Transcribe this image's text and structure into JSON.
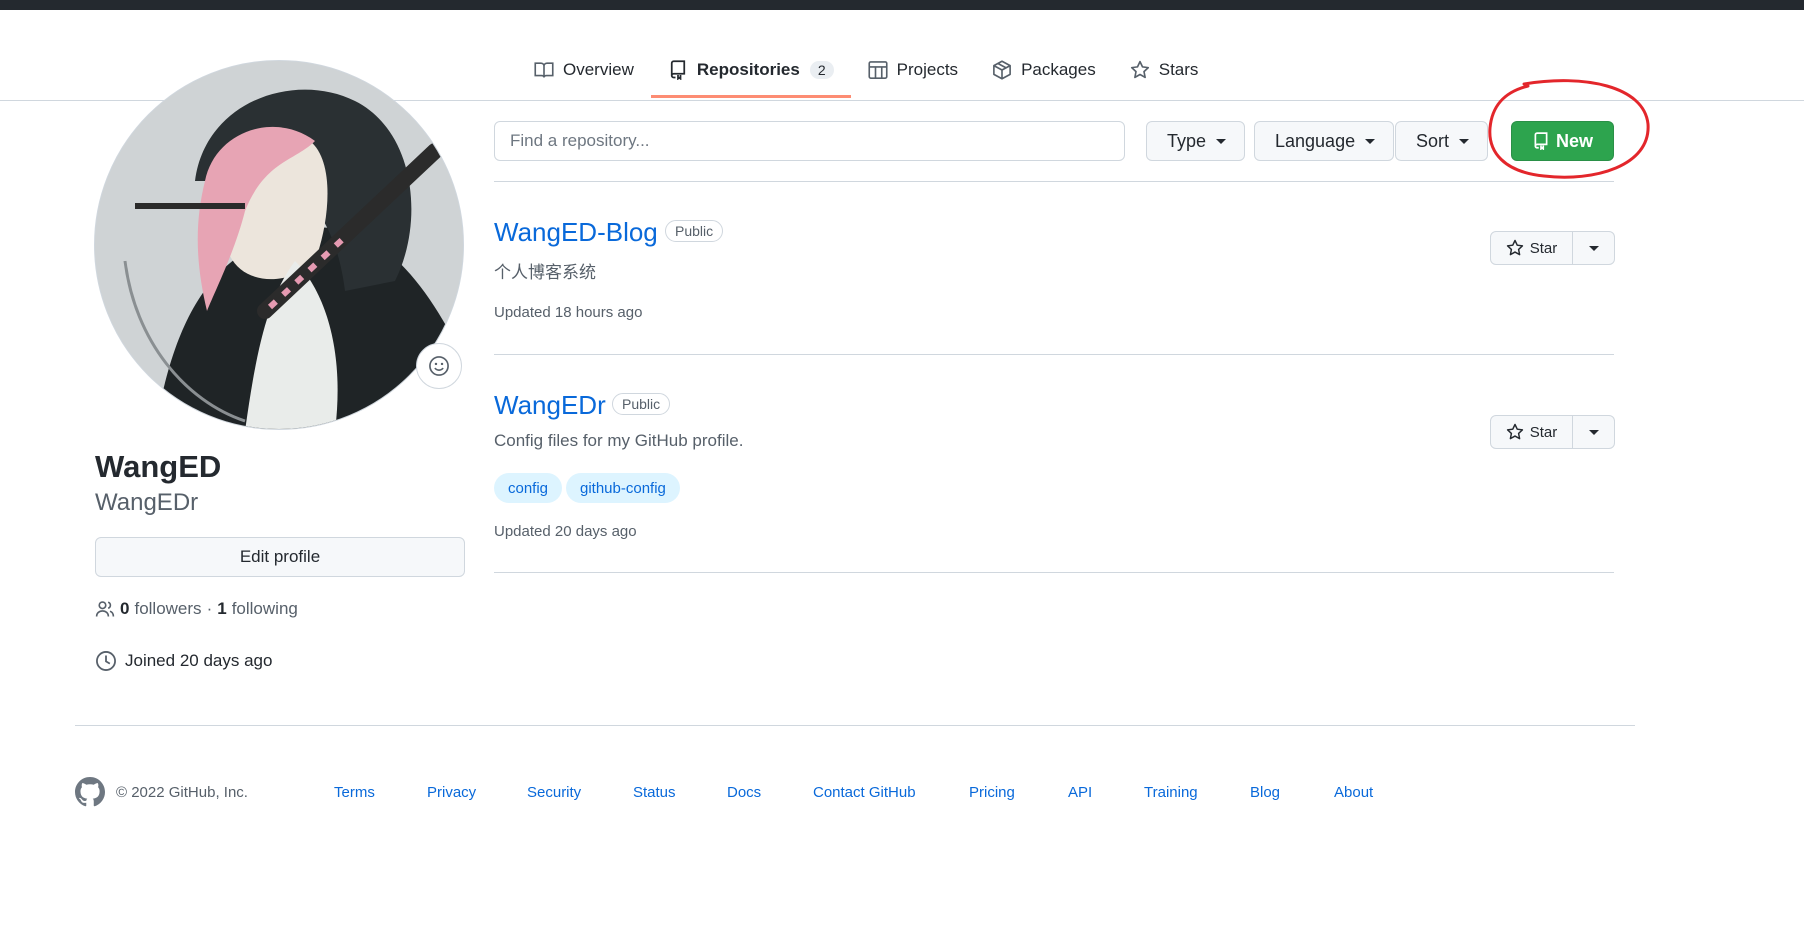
{
  "colors": {
    "accent": "#0969da",
    "new_button": "#2da44e",
    "active_tab_underline": "#fd8c73",
    "annotation": "#e3262b"
  },
  "tabs": [
    {
      "label": "Overview",
      "icon": "book-icon"
    },
    {
      "label": "Repositories",
      "icon": "repo-icon",
      "count": "2"
    },
    {
      "label": "Projects",
      "icon": "table-icon"
    },
    {
      "label": "Packages",
      "icon": "package-icon"
    },
    {
      "label": "Stars",
      "icon": "star-icon"
    }
  ],
  "profile": {
    "name": "WangED",
    "login": "WangEDr",
    "edit_label": "Edit profile",
    "followers_count": "0",
    "followers_label": "followers",
    "separator": "·",
    "following_count": "1",
    "following_label": "following",
    "joined": "Joined 20 days ago"
  },
  "filters": {
    "search_placeholder": "Find a repository...",
    "type_label": "Type",
    "language_label": "Language",
    "sort_label": "Sort",
    "new_label": "New"
  },
  "repos": [
    {
      "name": "WangED-Blog",
      "visibility": "Public",
      "description": "个人博客系统",
      "topics": [],
      "updated": "Updated 18 hours ago",
      "star_label": "Star"
    },
    {
      "name": "WangEDr",
      "visibility": "Public",
      "description": "Config files for my GitHub profile.",
      "topics": [
        "config",
        "github-config"
      ],
      "updated": "Updated 20 days ago",
      "star_label": "Star"
    }
  ],
  "footer": {
    "copyright": "© 2022 GitHub, Inc.",
    "links": [
      "Terms",
      "Privacy",
      "Security",
      "Status",
      "Docs",
      "Contact GitHub",
      "Pricing",
      "API",
      "Training",
      "Blog",
      "About"
    ]
  }
}
